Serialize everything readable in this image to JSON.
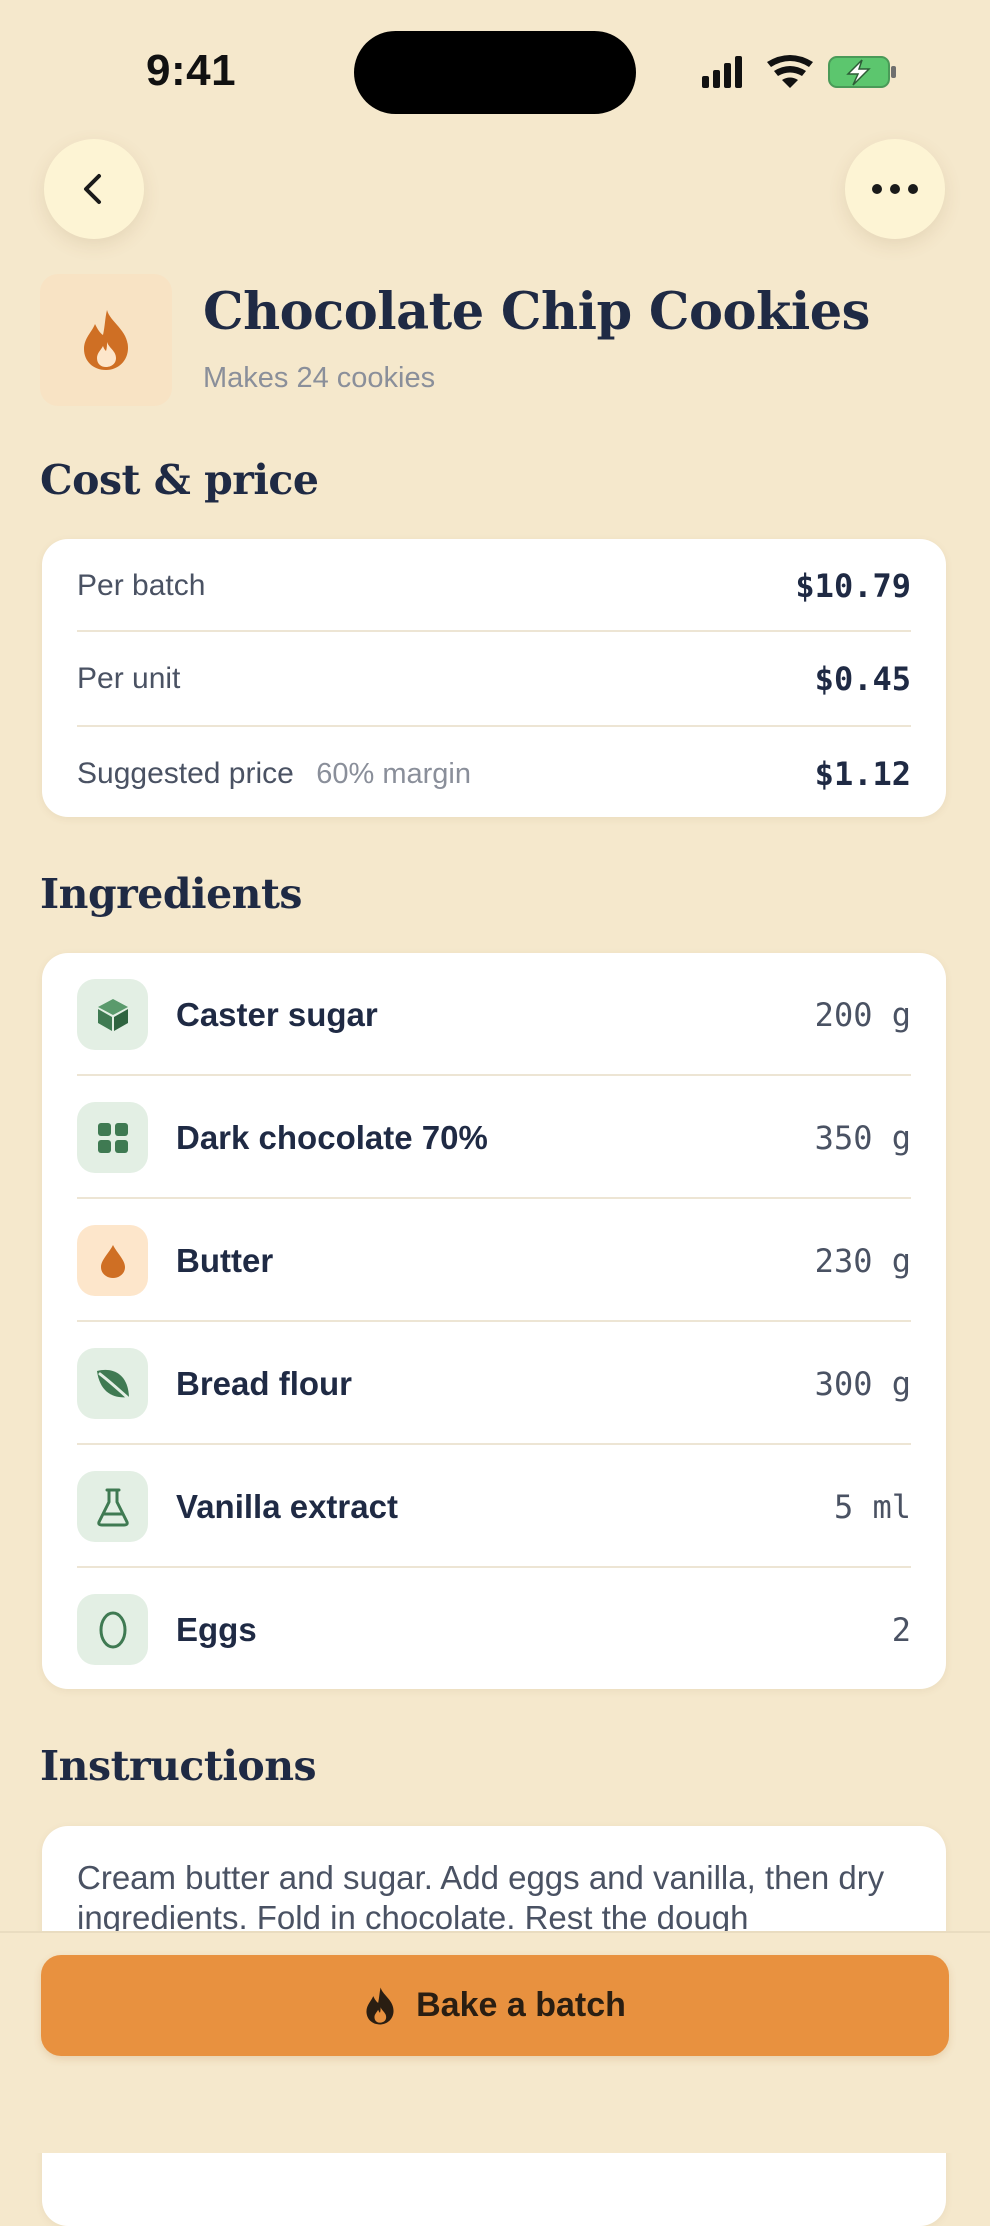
{
  "status_bar": {
    "time": "9:41",
    "icons": [
      "signal-icon",
      "wifi-icon",
      "battery-charging-icon"
    ]
  },
  "header": {
    "back_icon": "chevron-left-icon",
    "more_icon": "ellipsis-icon"
  },
  "recipe": {
    "icon": "flame-icon",
    "title": "Chocolate Chip Cookies",
    "subtitle": "Makes 24 cookies"
  },
  "cost": {
    "heading": "Cost & price",
    "rows": [
      {
        "label": "Per batch",
        "note": "",
        "value": "$10.79"
      },
      {
        "label": "Per unit",
        "note": "",
        "value": "$0.45"
      },
      {
        "label": "Suggested price",
        "note": "60% margin",
        "value": "$1.12"
      }
    ]
  },
  "ingredients": {
    "heading": "Ingredients",
    "items": [
      {
        "name": "Caster sugar",
        "qty": "200 g",
        "icon": "cube-icon",
        "tint": "green"
      },
      {
        "name": "Dark chocolate 70%",
        "qty": "350 g",
        "icon": "grid-icon",
        "tint": "green"
      },
      {
        "name": "Butter",
        "qty": "230 g",
        "icon": "droplet-icon",
        "tint": "orange"
      },
      {
        "name": "Bread flour",
        "qty": "300 g",
        "icon": "leaf-icon",
        "tint": "green"
      },
      {
        "name": "Vanilla extract",
        "qty": "5 ml",
        "icon": "flask-icon",
        "tint": "green"
      },
      {
        "name": "Eggs",
        "qty": "2",
        "icon": "egg-icon",
        "tint": "green"
      }
    ]
  },
  "instructions": {
    "heading": "Instructions",
    "text": "Cream butter and sugar. Add eggs and vanilla, then dry ingredients. Fold in chocolate. Rest the dough"
  },
  "action": {
    "label": "Bake a batch",
    "icon": "flame-icon"
  },
  "colors": {
    "background": "#f5e8cc",
    "accent": "#e8913f",
    "green_icon": "#3f7a52",
    "orange_icon": "#cf6f24",
    "heading": "#1f2a44"
  }
}
